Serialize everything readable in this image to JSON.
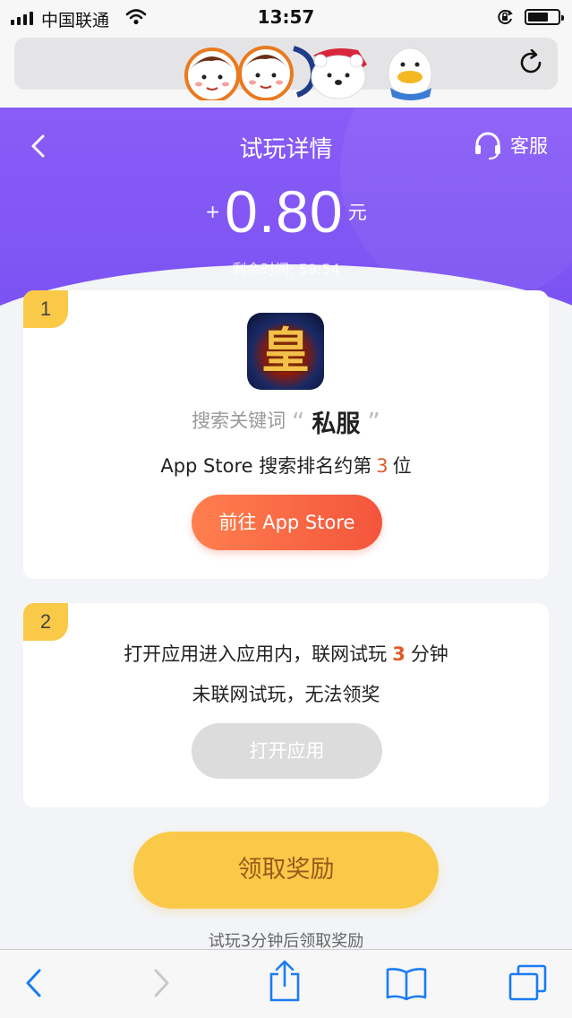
{
  "status_bar": {
    "carrier": "中国联通",
    "time": "13:57"
  },
  "header": {
    "title": "试玩详情",
    "service_label": "客服",
    "amount_sign": "+",
    "amount": "0.80",
    "amount_unit": "元",
    "remaining_label": "剩余时间:",
    "remaining_time": "59:54"
  },
  "step1": {
    "number": "1",
    "app_icon_char": "皇",
    "keyword_prefix": "搜索关键词",
    "quote_open": "“",
    "keyword": "私服",
    "quote_close": "”",
    "rank_prefix": "App Store 搜索排名约第",
    "rank_value": "3",
    "rank_suffix": "位",
    "button_label": "前往 App Store"
  },
  "step2": {
    "number": "2",
    "line1_prefix": "打开应用进入应用内，联网试玩",
    "line1_value": "3",
    "line1_suffix": "分钟",
    "line2": "未联网试玩，无法领奖",
    "button_label": "打开应用"
  },
  "reward": {
    "button_label": "领取奖励",
    "tip": "试玩3分钟后领取奖励"
  },
  "colors": {
    "header_purple": "#8a5cf7",
    "accent_orange": "#f4553c",
    "reward_yellow": "#fbc948",
    "ios_blue": "#1a7cf5"
  }
}
